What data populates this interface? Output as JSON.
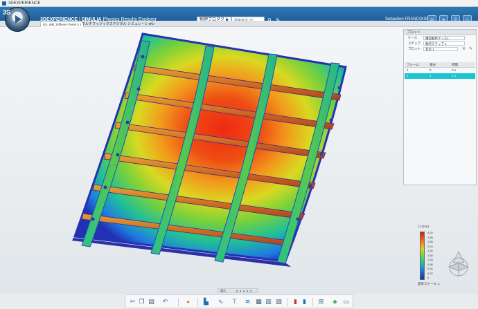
{
  "window": {
    "title": "3DEXPERIENCE"
  },
  "header": {
    "brand_3d": "3DEXPERIENCE",
    "brand_sep": " | ",
    "brand_company": "SIMULIA",
    "app_name": "Physics Results Explorer",
    "search_scope": "物理プロダクト",
    "search_placeholder": "検索条件 (5)",
    "user": "Sebastien FRANCOISE",
    "brand_color": "#1f6aa8"
  },
  "tabs": [
    {
      "label": "DS_WB_Stiffener Panel 4.1"
    }
  ],
  "tab_title": "マルチフィジックスデジタル シミュレーション",
  "plot_panel": {
    "title": "プロット",
    "case_label": "ケース",
    "case_value": "構造解析ケース1",
    "step_label": "ステップ",
    "step_value": "静的ステップ 1",
    "plot_label": "プロット",
    "plot_value": "変位 1",
    "table_headers": [
      "フレーム",
      "増分",
      "時間"
    ],
    "rows": [
      [
        "1",
        "0",
        "0 s"
      ],
      [
        "2",
        "1",
        "1 s"
      ]
    ],
    "selected_row_color": "#18c4d1"
  },
  "legend": {
    "title": "U (mm)",
    "ticks": [
      "3.20",
      "2.88",
      "2.56",
      "2.24",
      "1.92",
      "1.60",
      "1.28",
      "0.96",
      "0.64",
      "0.32",
      "0"
    ],
    "scale_label": "変形スケール: 1"
  },
  "page_indicator": {
    "label": "表示"
  },
  "toolbar": {
    "icons": [
      "scissors-icon",
      "copy-icon",
      "paste-icon",
      "undo-icon",
      "color-plot-icon",
      "chart-icon",
      "xy-plot-icon",
      "probe-icon",
      "arrow-icon",
      "table-icon",
      "report-icon",
      "legend-icon",
      "grid-icon",
      "display-icon",
      "layers-icon"
    ]
  }
}
